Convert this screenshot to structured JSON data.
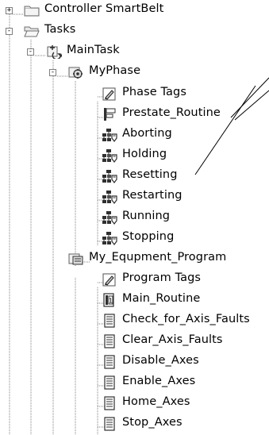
{
  "tree": {
    "rows": [
      {
        "label": "Controller SmartBelt",
        "icon": "folder-icon",
        "expander": "+"
      },
      {
        "label": "Tasks",
        "icon": "open-folder-icon",
        "expander": "-"
      },
      {
        "label": "MainTask",
        "icon": "task-icon",
        "expander": "-"
      },
      {
        "label": "MyPhase",
        "icon": "phase-icon",
        "expander": "-"
      },
      {
        "label": "Phase Tags",
        "icon": "tags-icon",
        "expander": ""
      },
      {
        "label": "Prestate_Routine",
        "icon": "prestate-routine-icon",
        "expander": ""
      },
      {
        "label": "Aborting",
        "icon": "state-routine-icon",
        "expander": ""
      },
      {
        "label": "Holding",
        "icon": "state-routine-icon",
        "expander": ""
      },
      {
        "label": "Resetting",
        "icon": "state-routine-icon",
        "expander": ""
      },
      {
        "label": "Restarting",
        "icon": "state-routine-icon",
        "expander": ""
      },
      {
        "label": "Running",
        "icon": "state-routine-icon",
        "expander": ""
      },
      {
        "label": "Stopping",
        "icon": "state-routine-icon",
        "expander": ""
      },
      {
        "label": "My_Equpment_Program",
        "icon": "program-icon",
        "expander": "-"
      },
      {
        "label": "Program Tags",
        "icon": "tags-icon",
        "expander": ""
      },
      {
        "label": "Main_Routine",
        "icon": "main-routine-icon",
        "expander": ""
      },
      {
        "label": "Check_for_Axis_Faults",
        "icon": "routine-icon",
        "expander": ""
      },
      {
        "label": "Clear_Axis_Faults",
        "icon": "routine-icon",
        "expander": ""
      },
      {
        "label": "Disable_Axes",
        "icon": "routine-icon",
        "expander": ""
      },
      {
        "label": "Enable_Axes",
        "icon": "routine-icon",
        "expander": ""
      },
      {
        "label": "Home_Axes",
        "icon": "routine-icon",
        "expander": ""
      },
      {
        "label": "Stop_Axes",
        "icon": "routine-icon",
        "expander": ""
      }
    ]
  },
  "colors": {
    "tree_lines": "#808080",
    "callout_lines": "#000000",
    "background": "#ffffff"
  }
}
